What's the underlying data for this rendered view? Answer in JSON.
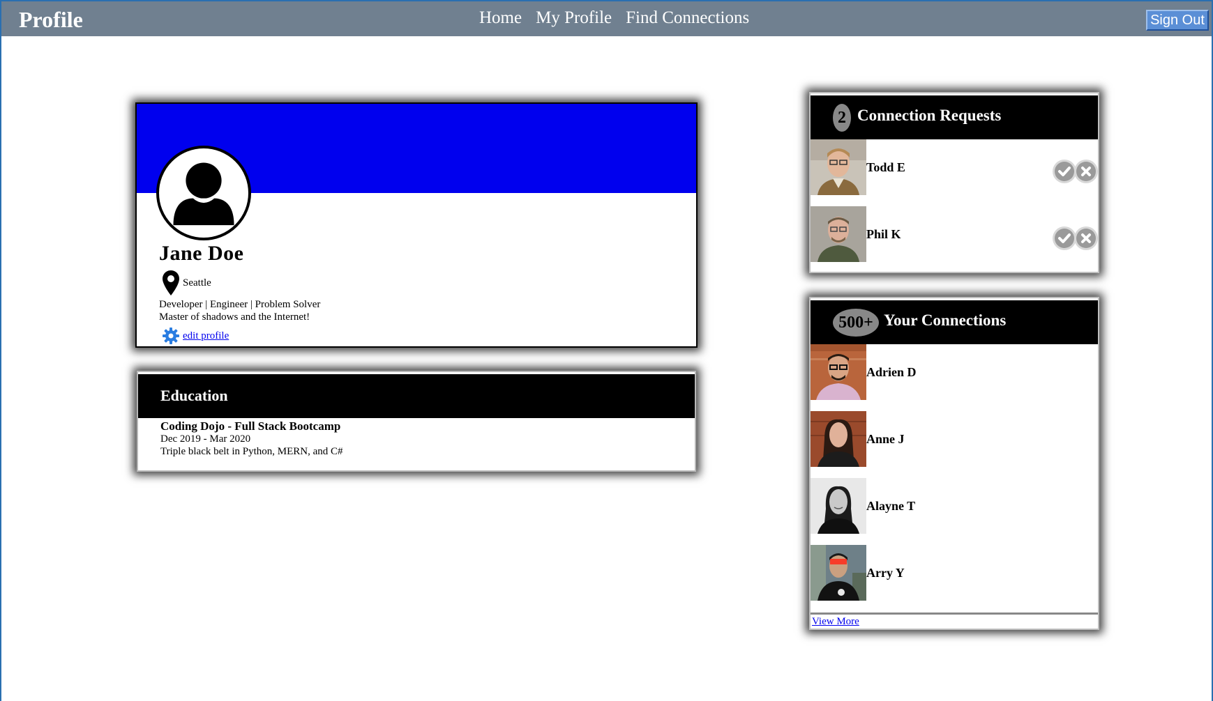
{
  "nav": {
    "brand": "Profile",
    "links": [
      "Home",
      "My Profile",
      "Find Connections"
    ],
    "signout_label": "Sign Out"
  },
  "profile": {
    "name": "Jane Doe",
    "location": "Seattle",
    "bio_line1": "Developer | Engineer | Problem Solver",
    "bio_line2": "Master of shadows and the Internet!",
    "edit_label": "edit profile",
    "banner_color": "#0000ee"
  },
  "education": {
    "heading": "Education",
    "school": "Coding Dojo - Full Stack Bootcamp",
    "dates": "Dec 2019 - Mar 2020",
    "description": "Triple black belt in Python, MERN, and C#"
  },
  "requests": {
    "count": "2",
    "title": "Connection Requests",
    "people": [
      {
        "name": "Todd E"
      },
      {
        "name": "Phil K"
      }
    ]
  },
  "connections": {
    "count": "500+",
    "title": "Your Connections",
    "people": [
      {
        "name": "Adrien D"
      },
      {
        "name": "Anne J"
      },
      {
        "name": "Alayne T"
      },
      {
        "name": "Arry Y"
      }
    ],
    "view_more_label": "View More"
  },
  "icons": {
    "avatar": "user-silhouette-icon",
    "location": "map-pin-icon",
    "edit": "gear-icon",
    "accept": "check-icon",
    "decline": "close-icon"
  },
  "colors": {
    "navbar": "#708090",
    "signout": "#5b8fd6",
    "header": "#000000",
    "link": "#0000ee"
  }
}
